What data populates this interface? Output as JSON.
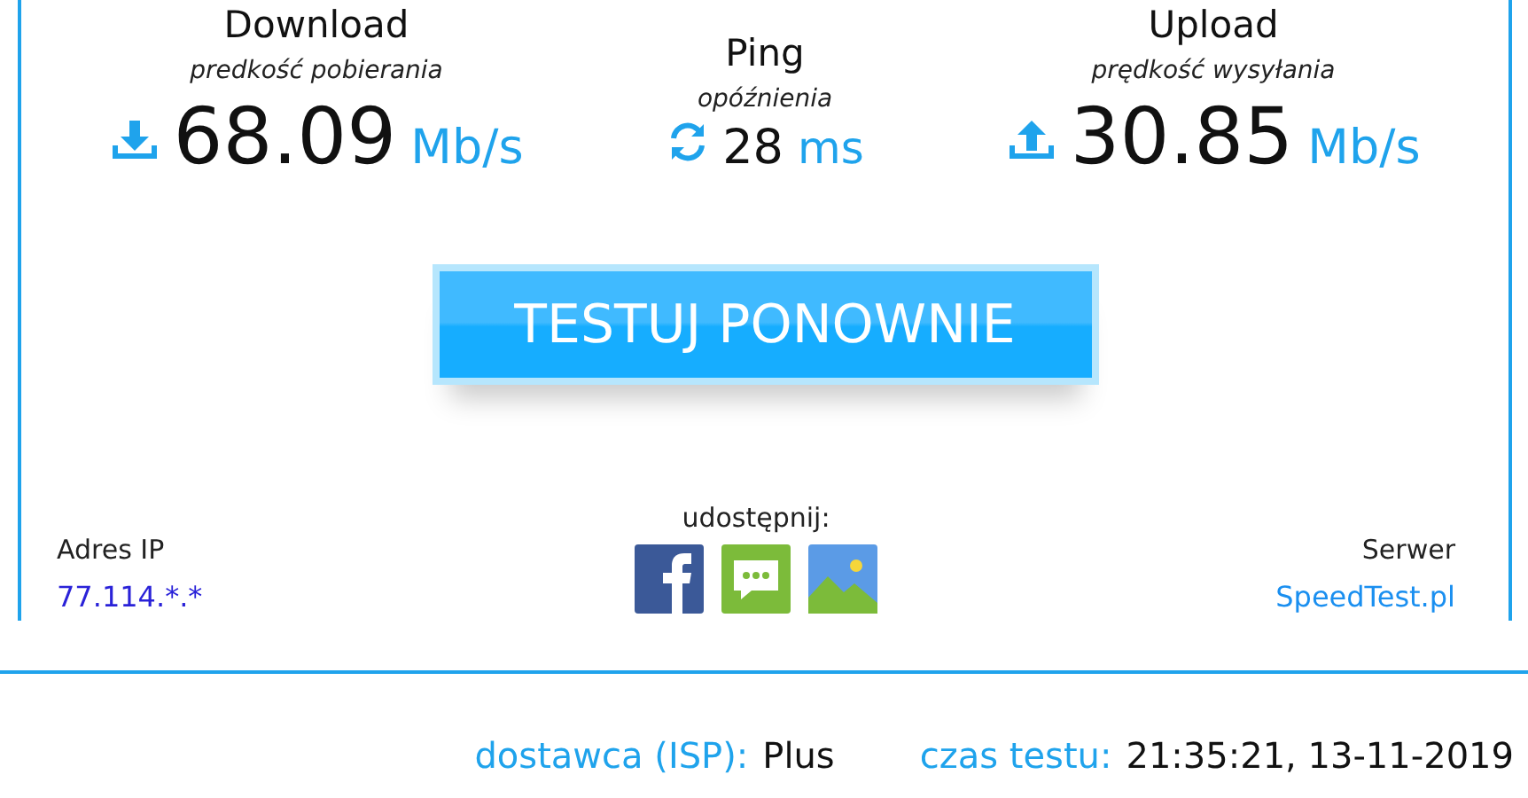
{
  "metrics": [
    {
      "kind": "download",
      "title": "Download",
      "subtitle": "predkość pobierania",
      "value": "68.09",
      "unit": "Mb/s"
    },
    {
      "kind": "ping",
      "title": "Ping",
      "subtitle": "opóźnienia",
      "value": "28",
      "unit": "ms"
    },
    {
      "kind": "upload",
      "title": "Upload",
      "subtitle": "prędkość wysyłania",
      "value": "30.85",
      "unit": "Mb/s"
    }
  ],
  "retest_button": "TESTUJ PONOWNIE",
  "ip": {
    "label": "Adres IP",
    "value": "77.114.*.*"
  },
  "share": {
    "label": "udostępnij:",
    "icons": [
      {
        "kind": "facebook"
      },
      {
        "kind": "message"
      },
      {
        "kind": "image"
      }
    ]
  },
  "server": {
    "label": "Serwer",
    "value": "SpeedTest.pl"
  },
  "footer": [
    {
      "label": "dostawca (ISP):",
      "value": "Plus"
    },
    {
      "label": "czas testu:",
      "value": "21:35:21, 13-11-2019"
    }
  ]
}
